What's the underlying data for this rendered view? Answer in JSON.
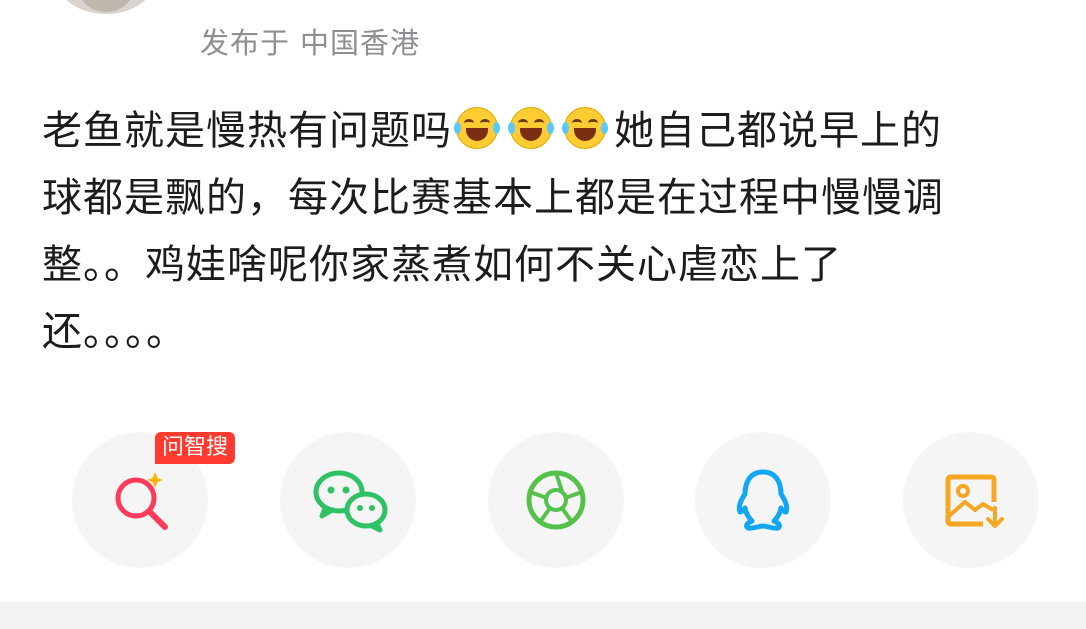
{
  "post": {
    "published_prefix": "发布于",
    "location": "中国香港",
    "content_lines": [
      [
        "老鱼就是慢热有问题吗",
        "她自己都说早上的"
      ],
      [
        "球都是飘的，每次比赛基本上都是在过程中慢慢调"
      ],
      [
        "整。。鸡娃啥呢你家蒸煮如何不关心虐恋上了"
      ],
      [
        "还。。。。"
      ]
    ],
    "line1_part1": "老鱼就是慢热有问题吗",
    "line1_part2": "她自己都说早上的",
    "line2": "球都是飘的，每次比赛基本上都是在过程中慢慢调",
    "line3": "整。。鸡娃啥呢你家蒸煮如何不关心虐恋上了",
    "line4": "还。。。。",
    "emoji_count": 3,
    "emoji_name": "laugh-cry-emoji"
  },
  "share": {
    "badge": "问智搜",
    "buttons": [
      {
        "icon": "ai-search-icon",
        "color": "#ff3b5c"
      },
      {
        "icon": "wechat-icon",
        "color": "#2ec264"
      },
      {
        "icon": "moments-icon",
        "color": "#54c24a"
      },
      {
        "icon": "qq-icon",
        "color": "#12a6f5"
      },
      {
        "icon": "save-image-icon",
        "color": "#f5a623"
      }
    ]
  }
}
